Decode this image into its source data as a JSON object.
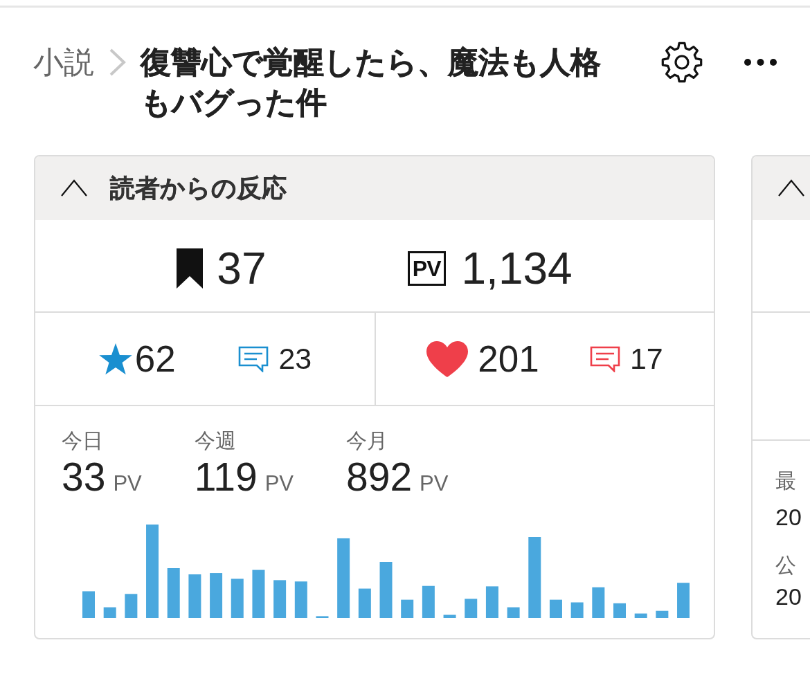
{
  "breadcrumb": {
    "parent": "小説",
    "title": "復讐心で覚醒したら、魔法も人格もバグった件"
  },
  "reactions_panel": {
    "title": "読者からの反応",
    "expanded": true,
    "bookmarks": "37",
    "pv_label": "PV",
    "page_views": "1,134",
    "ratings": [
      {
        "kind": "star",
        "count": "62",
        "comments": "23",
        "color": "#1a8fd0"
      },
      {
        "kind": "heart",
        "count": "201",
        "comments": "17",
        "color": "#ef3f4a"
      }
    ],
    "stats": [
      {
        "label": "今日",
        "value": "33",
        "unit": "PV"
      },
      {
        "label": "今週",
        "value": "119",
        "unit": "PV"
      },
      {
        "label": "今月",
        "value": "892",
        "unit": "PV"
      }
    ]
  },
  "second_panel": {
    "expanded": true,
    "fields": [
      {
        "label": "最",
        "value": "20"
      },
      {
        "label": "公",
        "value": "20"
      }
    ]
  }
}
